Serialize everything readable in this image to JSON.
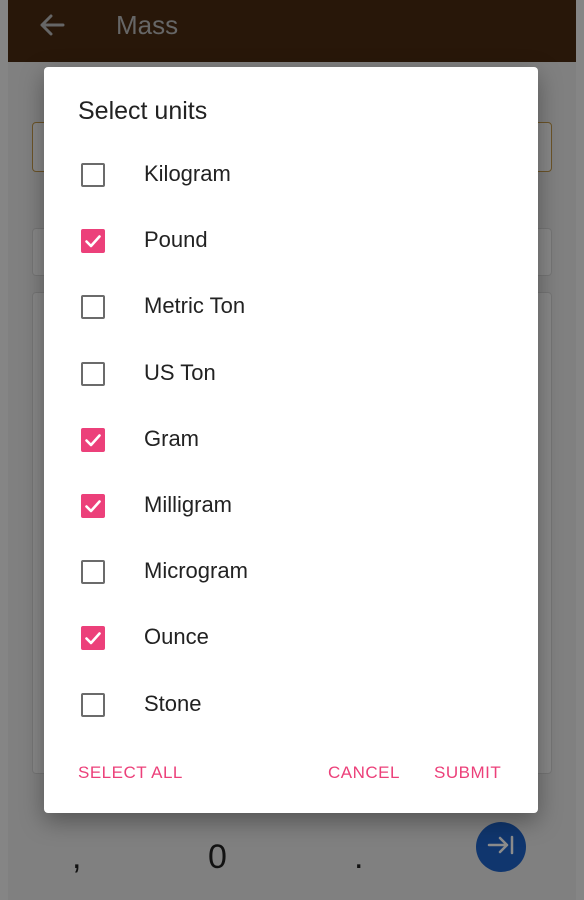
{
  "appbar": {
    "title": "Mass"
  },
  "keypad": {
    "comma": ",",
    "zero": "0",
    "dot": "."
  },
  "dialog": {
    "title": "Select units",
    "options": [
      {
        "label": "Kilogram",
        "checked": false
      },
      {
        "label": "Pound",
        "checked": true
      },
      {
        "label": "Metric Ton",
        "checked": false
      },
      {
        "label": "US Ton",
        "checked": false
      },
      {
        "label": "Gram",
        "checked": true
      },
      {
        "label": "Milligram",
        "checked": true
      },
      {
        "label": "Microgram",
        "checked": false
      },
      {
        "label": "Ounce",
        "checked": true
      },
      {
        "label": "Stone",
        "checked": false
      }
    ],
    "select_all_label": "SELECT ALL",
    "cancel_label": "CANCEL",
    "submit_label": "SUBMIT"
  },
  "colors": {
    "accent": "#ec407a",
    "appbar": "#4a2a12",
    "fab": "#1e63c8"
  }
}
